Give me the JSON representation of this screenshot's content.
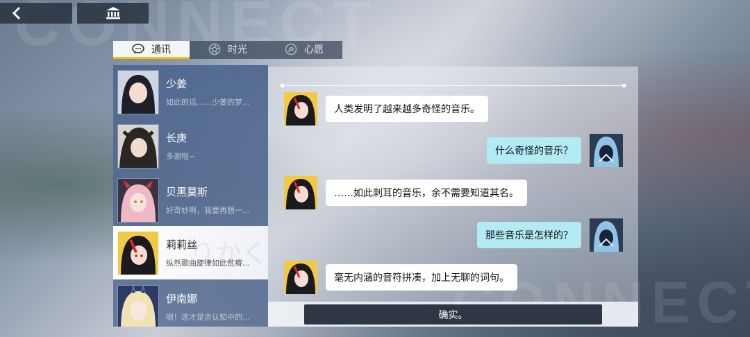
{
  "header": {
    "back_icon": "chevron-left-icon",
    "bank_icon": "bank-building-icon"
  },
  "watermark": {
    "top": "CONNECT",
    "bottom": "CONNECT"
  },
  "tabs": [
    {
      "label": "通讯",
      "icon": "chat-bubble-icon",
      "active": true
    },
    {
      "label": "时光",
      "icon": "aperture-icon",
      "active": false
    },
    {
      "label": "心愿",
      "icon": "wish-icon",
      "active": false
    }
  ],
  "contacts": [
    {
      "name": "少姜",
      "preview": "如此的话……少姜的梦…"
    },
    {
      "name": "长庚",
      "preview": "多谢啦~"
    },
    {
      "name": "贝黑莫斯",
      "preview": "好奇妙啊，我要再想一…"
    },
    {
      "name": "莉莉丝",
      "preview": "纵然歌曲旋律如此贫瘠…",
      "active": true,
      "kana": "りかく"
    },
    {
      "name": "伊南娜",
      "preview": "嗯！这才是余认知中的…"
    }
  ],
  "messages": [
    {
      "side": "left",
      "text": "人类发明了越来越多奇怪的音乐。"
    },
    {
      "side": "right",
      "text": "什么奇怪的音乐？"
    },
    {
      "side": "left",
      "text": "……如此刺耳的音乐，余不需要知道其名。"
    },
    {
      "side": "right",
      "text": "那些音乐是怎样的？"
    },
    {
      "side": "left",
      "text": "毫无内涵的音符拼凑，加上无聊的词句。"
    }
  ],
  "reply_button": "确实。",
  "colors": {
    "accent_yellow": "#f2c400",
    "reply_bubble": "#b3ebf5",
    "sidebar": "#4e668e"
  }
}
